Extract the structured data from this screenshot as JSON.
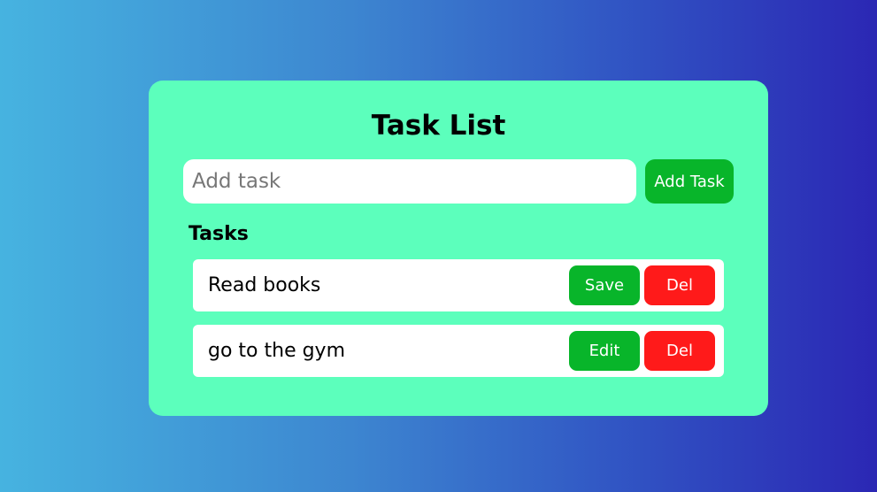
{
  "app": {
    "title": "Task List"
  },
  "input": {
    "placeholder": "Add task",
    "value": ""
  },
  "toolbar": {
    "add_label": "Add Task"
  },
  "tasks_section": {
    "label": "Tasks",
    "items": [
      {
        "text": "Read books",
        "primary_action": "Save",
        "delete_action": "Del"
      },
      {
        "text": "go to the gym",
        "primary_action": "Edit",
        "delete_action": "Del"
      }
    ]
  },
  "colors": {
    "card_bg": "#5cffbc",
    "action_green": "#08b52a",
    "action_red": "#ff1a1a",
    "gradient_start": "#46b3e0",
    "gradient_end": "#2b27b4"
  }
}
